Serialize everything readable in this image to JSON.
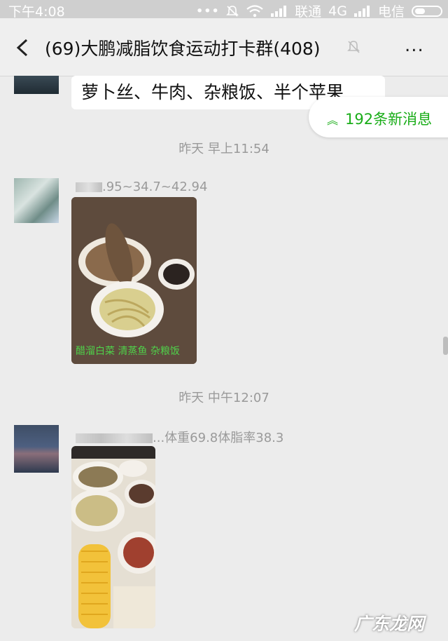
{
  "status_bar": {
    "time": "下午4:08",
    "carrier1": "联通",
    "network": "4G",
    "carrier2": "电信"
  },
  "header": {
    "title": "(69)大鹏减脂饮食运动打卡群(408)",
    "more": "..."
  },
  "new_messages_label": "192条新消息",
  "messages": {
    "m1_text": "萝卜丝、牛肉、杂粮饭、半个苹果",
    "ts1": "昨天 早上11:54",
    "m2_sender_text": ".95~34.7~42.94",
    "m2_photo_caption": "醋溜白菜 清蒸鱼 杂粮饭",
    "ts2": "昨天 中午12:07",
    "m3_sender_text": "...体重69.8体脂率38.3"
  },
  "watermark": "广东龙网"
}
